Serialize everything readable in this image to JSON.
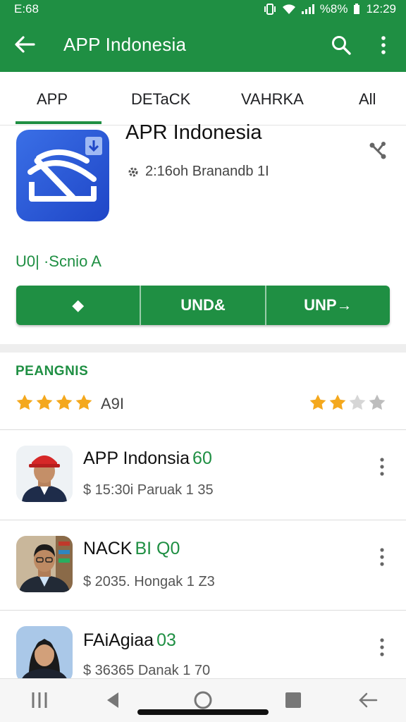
{
  "status_bar": {
    "time_left": "E:68",
    "battery": "%8%",
    "time_right": "12:29"
  },
  "app_bar": {
    "title": "APP Indonesia",
    "back_icon": "arrow-left-icon",
    "search_icon": "search-icon",
    "more_icon": "more-vert-icon"
  },
  "tabs": [
    {
      "label": "APP",
      "active": true
    },
    {
      "label": "DETaCK",
      "active": false
    },
    {
      "label": "VAHRKA",
      "active": false
    },
    {
      "label": "All",
      "active": false
    }
  ],
  "app_header": {
    "name": "APR Indonesia",
    "subtitle": "2:16oh Branandb 1I",
    "green_label": "U0| ·Scnio A",
    "share_icon": "share-icon"
  },
  "action_buttons": [
    {
      "label": "◆"
    },
    {
      "label": "UND&"
    },
    {
      "label": "UNP→"
    }
  ],
  "ratings": {
    "heading": "PEANGNIS",
    "left_stars": 4,
    "left_text": "A9I",
    "right_stars_filled": 2,
    "right_stars_total": 4
  },
  "list": [
    {
      "title": "APP Indonsia",
      "badge": "60",
      "subtitle": "$ 15:30i Paruak 1 35"
    },
    {
      "title": "NACK",
      "badge": "BI Q0",
      "subtitle": "$ 2035. Hongak 1 Z3"
    },
    {
      "title": "FAiAgiaa",
      "badge": "03",
      "subtitle": "$ 36365 Danak 1 70"
    }
  ],
  "colors": {
    "brand": "#1f8f43",
    "star": "#f4a81d"
  }
}
